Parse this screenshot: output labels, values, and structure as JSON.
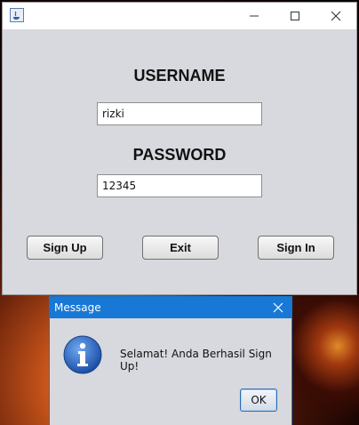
{
  "main_window": {
    "controls": {
      "minimize": "minimize-icon",
      "maximize": "maximize-icon",
      "close": "close-icon"
    },
    "username_label": "USERNAME",
    "username_value": "rizki",
    "password_label": "PASSWORD",
    "password_value": "12345",
    "buttons": {
      "sign_up": "Sign Up",
      "exit": "Exit",
      "sign_in": "Sign In"
    }
  },
  "dialog": {
    "title": "Message",
    "message": "Selamat! Anda Berhasil Sign Up!",
    "ok_label": "OK",
    "icon": "info-icon"
  },
  "colors": {
    "window_bg": "#d7d9de",
    "dialog_titlebar": "#1878d6"
  }
}
